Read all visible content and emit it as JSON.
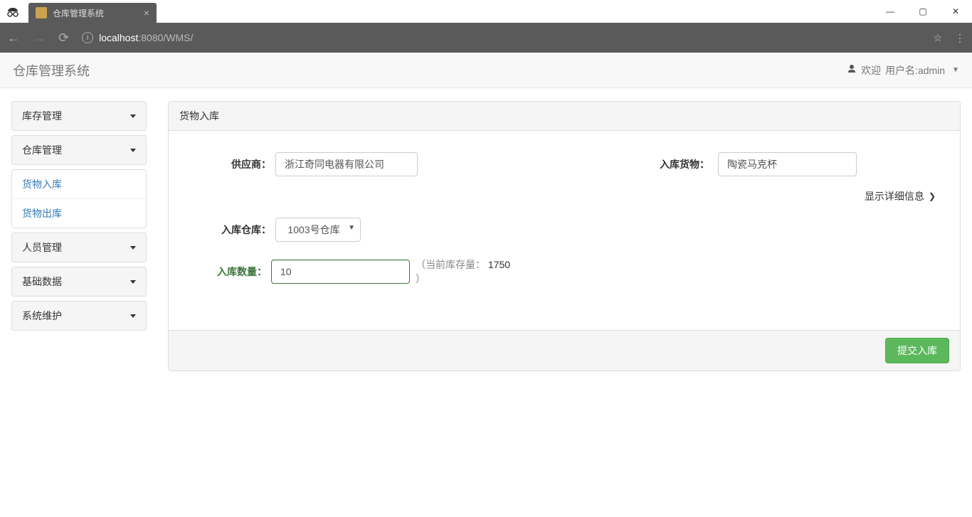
{
  "browser": {
    "tab_title": "仓库管理系统",
    "url_host": "localhost",
    "url_port": ":8080",
    "url_path": "/WMS/"
  },
  "header": {
    "brand": "仓库管理系统",
    "welcome": "欢迎",
    "username_label": "用户名:admin"
  },
  "sidebar": {
    "items": [
      {
        "label": "库存管理",
        "expanded": false
      },
      {
        "label": "仓库管理",
        "expanded": true,
        "children": [
          {
            "label": "货物入库"
          },
          {
            "label": "货物出库"
          }
        ]
      },
      {
        "label": "人员管理",
        "expanded": false
      },
      {
        "label": "基础数据",
        "expanded": false
      },
      {
        "label": "系统维护",
        "expanded": false
      }
    ]
  },
  "panel": {
    "title": "货物入库",
    "supplier_label": "供应商：",
    "supplier_value": "浙江奇同电器有限公司",
    "goods_label": "入库货物：",
    "goods_value": "陶瓷马克杯",
    "show_detail": "显示详细信息",
    "warehouse_label": "入库仓库：",
    "warehouse_value": "1003号仓库",
    "qty_label": "入库数量：",
    "qty_value": "10",
    "stock_hint_prefix": "（当前库存量：",
    "stock_value": "1750",
    "stock_hint_suffix": "）",
    "submit_label": "提交入库"
  }
}
